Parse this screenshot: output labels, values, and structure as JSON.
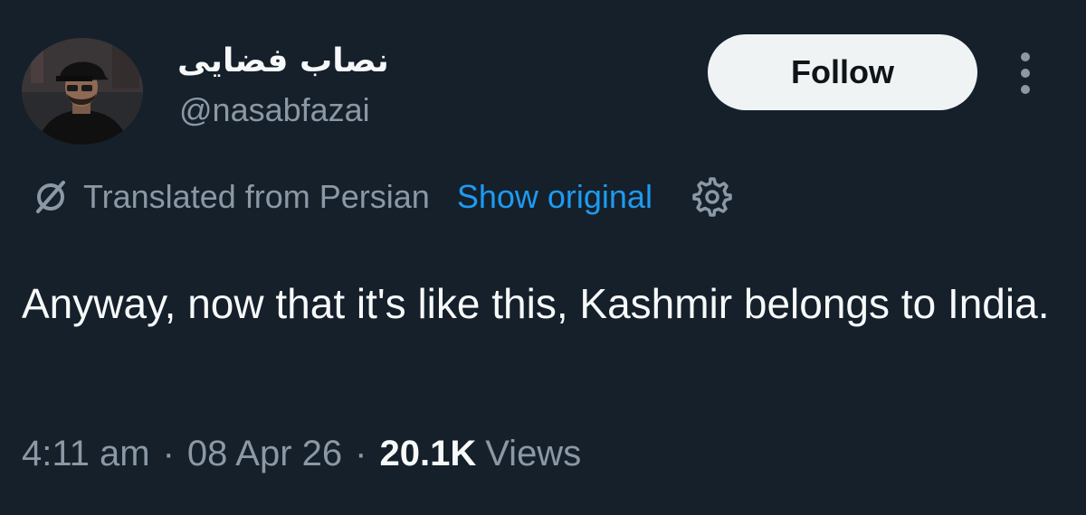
{
  "author": {
    "display_name": "نصاب فضایی",
    "handle": "@nasabfazai"
  },
  "actions": {
    "follow_label": "Follow",
    "more_icon": "more-vertical-icon"
  },
  "translation": {
    "icon": "translate-slash-icon",
    "label": "Translated from Persian",
    "show_original_label": "Show original",
    "settings_icon": "gear-icon"
  },
  "tweet": {
    "text": "Anyway, now that it's like this, Kashmir belongs to India."
  },
  "meta": {
    "time": "4:11 am",
    "separator": "·",
    "date": "08 Apr 26",
    "views_count": "20.1K",
    "views_label": "Views"
  },
  "colors": {
    "background": "#15202b",
    "primary_text": "#f7f9f9",
    "secondary_text": "#8b98a5",
    "link": "#1d9bf0",
    "follow_button_bg": "#eff3f4"
  }
}
